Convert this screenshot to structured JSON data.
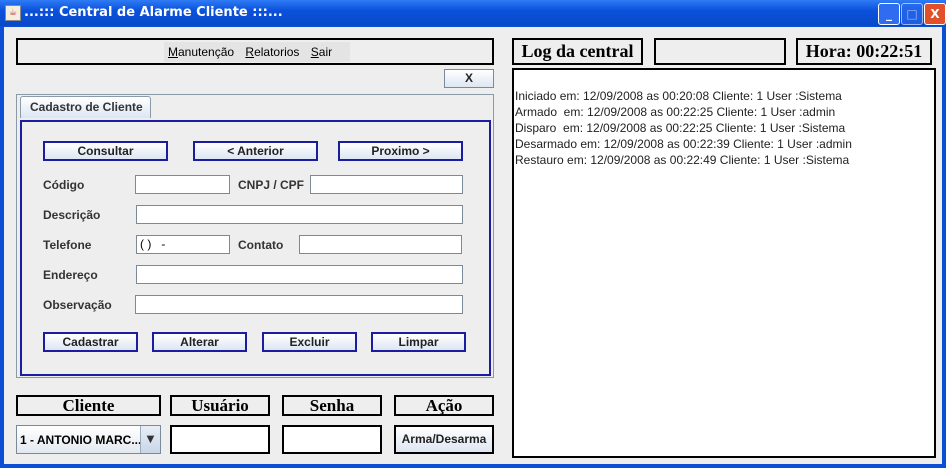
{
  "window": {
    "title": "...::: Central de Alarme Cliente :::..."
  },
  "menu": {
    "items": [
      "Manutenção",
      "Relatorios",
      "Sair"
    ]
  },
  "close_panel_label": "X",
  "tab": {
    "label": "Cadastro de Cliente"
  },
  "nav_buttons": {
    "consultar": "Consultar",
    "anterior": "< Anterior",
    "proximo": "Proximo >"
  },
  "form": {
    "codigo_label": "Código",
    "codigo_value": "",
    "cnpj_label": "CNPJ / CPF",
    "cnpj_value": "",
    "descricao_label": "Descrição",
    "descricao_value": "",
    "telefone_label": "Telefone",
    "telefone_value": "( )   -",
    "contato_label": "Contato",
    "contato_value": "",
    "endereco_label": "Endereço",
    "endereco_value": "",
    "observacao_label": "Observação",
    "observacao_value": ""
  },
  "action_buttons": {
    "cadastrar": "Cadastrar",
    "alterar": "Alterar",
    "excluir": "Excluir",
    "limpar": "Limpar"
  },
  "bottom": {
    "cliente_label": "Cliente",
    "usuario_label": "Usuário",
    "senha_label": "Senha",
    "acao_label": "Ação",
    "cliente_selected": "1 - ANTONIO MARC...",
    "arma_button": "Arma/Desarma"
  },
  "log": {
    "title": "Log da central",
    "status": "",
    "clock": "Hora: 00:22:51",
    "lines": [
      "Iniciado em: 12/09/2008 as 00:20:08 Cliente: 1 User :Sistema",
      "Armado  em: 12/09/2008 as 00:22:25 Cliente: 1 User :admin",
      "Disparo  em: 12/09/2008 as 00:22:25 Cliente: 1 User :Sistema",
      "Desarmado em: 12/09/2008 as 00:22:39 Cliente: 1 User :admin",
      "Restauro em: 12/09/2008 as 00:22:49 Cliente: 1 User :Sistema"
    ]
  }
}
